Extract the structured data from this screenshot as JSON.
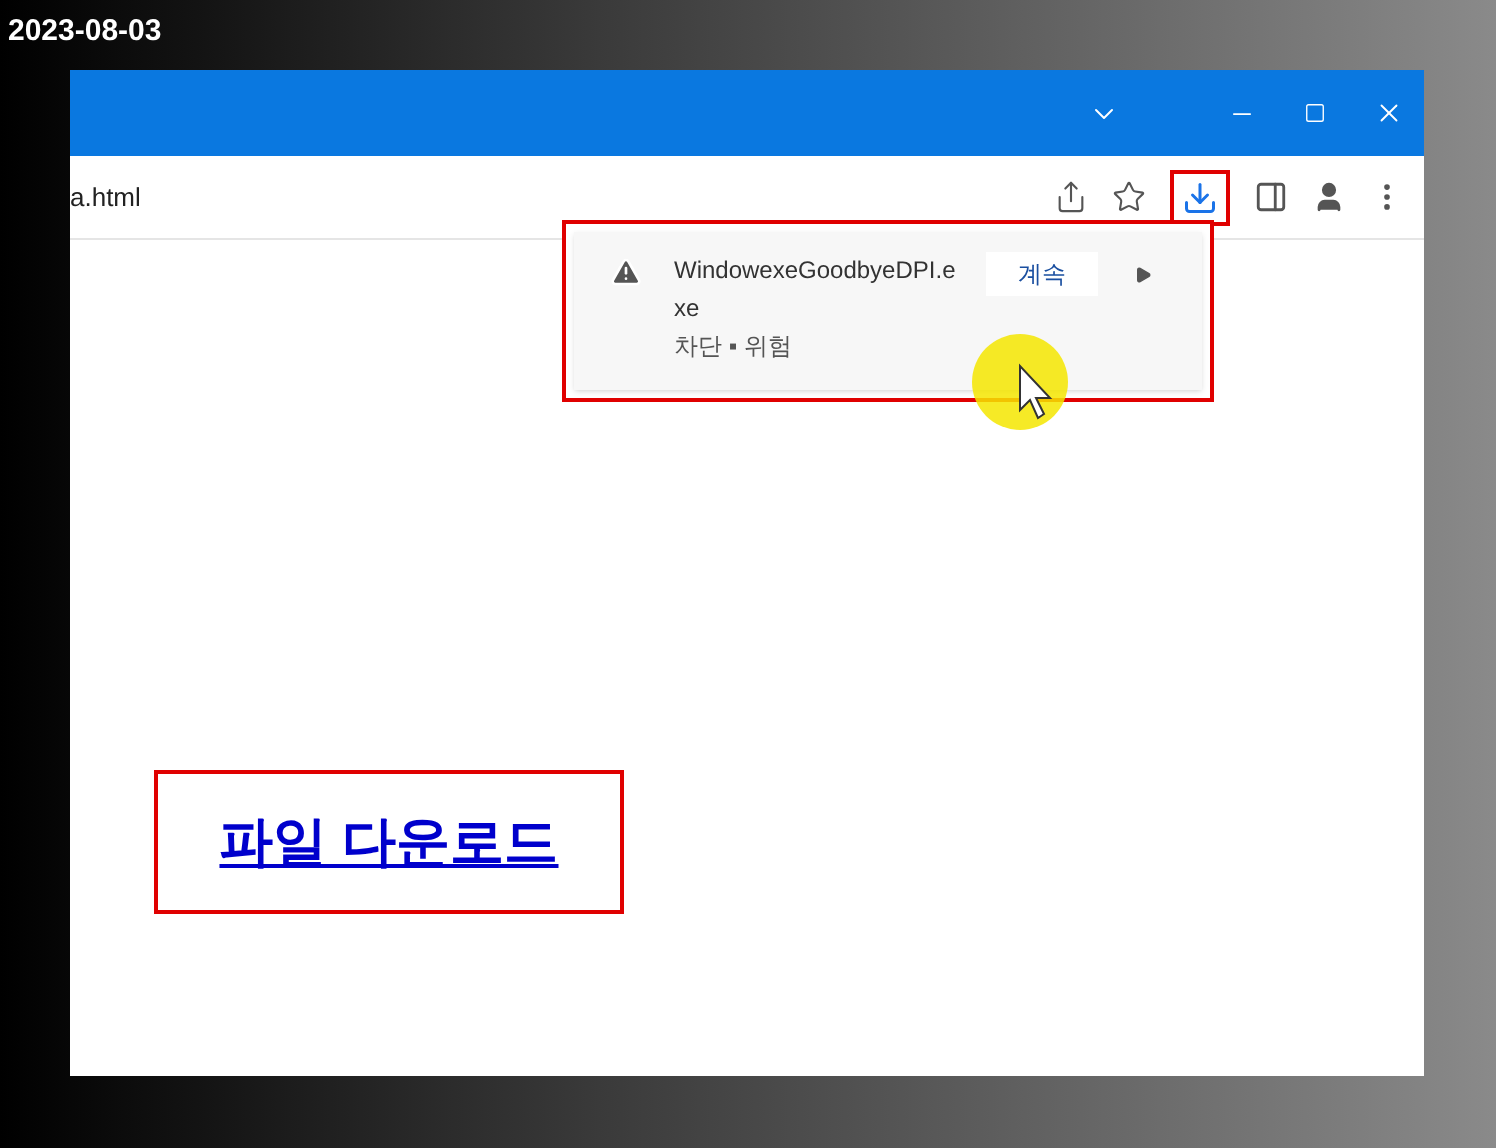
{
  "date_stamp": "2023-08-03",
  "address_bar": {
    "url": "a.html"
  },
  "download_popup": {
    "file_name": "WindowexeGoodbyeDPI.exe",
    "status": "차단 ▪ 위험",
    "button": "계속"
  },
  "page": {
    "link": "파일 다운로드"
  }
}
